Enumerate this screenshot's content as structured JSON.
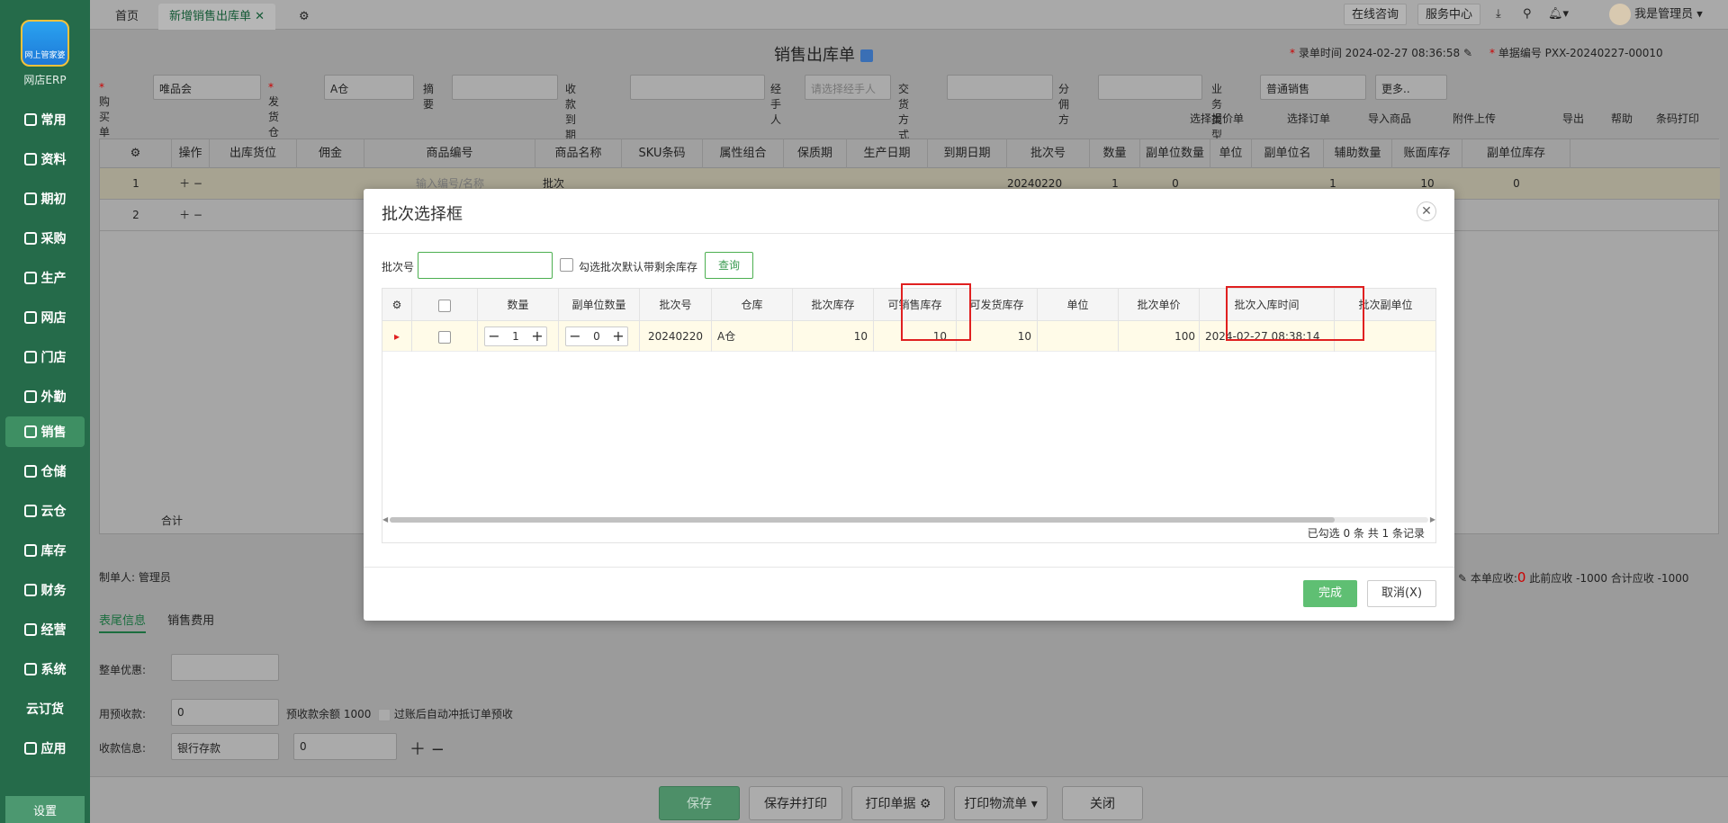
{
  "sidebar": {
    "logo_badge": "网上管家婆",
    "logo_text": "网店ERP",
    "items": [
      "常用",
      "资料",
      "期初",
      "采购",
      "生产",
      "网店",
      "门店",
      "外勤",
      "销售",
      "仓储",
      "云仓",
      "库存",
      "财务",
      "经营",
      "系统",
      "云订货",
      "应用"
    ],
    "bottom": "设置"
  },
  "topbar": {
    "tabs": [
      "首页",
      "新增销售出库单"
    ],
    "online": "在线咨询",
    "service": "服务中心",
    "user": "我是管理员"
  },
  "doc": {
    "title": "销售出库单",
    "time_label": "录单时间",
    "time_value": "2024-02-27 08:36:58",
    "no_label": "单据编号",
    "no_value": "PXX-20240227-00010"
  },
  "form": {
    "buyer_label": "购买单位",
    "buyer_value": "唯品会",
    "warehouse_label": "发货仓库",
    "warehouse_value": "A仓",
    "summary_label": "摘要",
    "due_label": "收款到期日期",
    "handler_label": "经手人",
    "handler_placeholder": "请选择经手人",
    "trade_label": "交货方式",
    "commission_label": "分佣方",
    "biz_label": "业务类型",
    "biz_value": "普通销售",
    "more": "更多.."
  },
  "toolbar2": {
    "quote": "选择报价单",
    "order": "选择订单",
    "import": "导入商品",
    "attach": "附件上传",
    "export": "导出",
    "help": "帮助",
    "barcode": "条码打印"
  },
  "grid": {
    "headers": [
      "操作",
      "出库货位",
      "佣金",
      "商品编号",
      "商品名称",
      "SKU条码",
      "属性组合",
      "保质期",
      "生产日期",
      "到期日期",
      "批次号",
      "数量",
      "副单位数量",
      "单位",
      "副单位名",
      "辅助数量",
      "账面库存",
      "副单位库存"
    ],
    "row1": {
      "no": "1",
      "code_placeholder": "输入编号/名称",
      "name": "批次",
      "batch": "20240220",
      "qty": "1",
      "subqty": "0",
      "aux": "1",
      "stock": "10",
      "substock": "0"
    },
    "row2": {
      "no": "2"
    },
    "total": "合计"
  },
  "footer": {
    "maker": "制单人: 管理员",
    "receivable_label": "本单应收:",
    "receivable_value": "0",
    "prev_label": "此前应收 -1000",
    "total_label": "合计应收 -1000",
    "tabs": [
      "表尾信息",
      "销售费用"
    ],
    "discount_label": "整单优惠:",
    "prepay_label": "用预收款:",
    "prepay_value": "0",
    "prepay_balance": "预收款余额 1000",
    "auto_offset": "过账后自动冲抵订单预收",
    "receipt_label": "收款信息:",
    "receipt_account": "银行存款",
    "receipt_value": "0"
  },
  "actions": {
    "save": "保存",
    "save_print": "保存并打印",
    "print_doc": "打印单据",
    "print_logistics": "打印物流单",
    "close": "关闭"
  },
  "modal": {
    "title": "批次选择框",
    "batch_label": "批次号",
    "batch_value": "",
    "check_label": "勾选批次默认带剩余库存",
    "query": "查询",
    "headers": [
      "数量",
      "副单位数量",
      "批次号",
      "仓库",
      "批次库存",
      "可销售库存",
      "可发货库存",
      "单位",
      "批次单价",
      "批次入库时间",
      "批次副单位"
    ],
    "row": {
      "qty": "1",
      "subqty": "0",
      "batch": "20240220",
      "warehouse": "A仓",
      "batch_stock": "10",
      "sellable": "10",
      "shippable": "10",
      "unit": "",
      "price": "100",
      "in_time": "2024-02-27 08:38:14"
    },
    "summary": "已勾选 0 条  共 1 条记录",
    "done": "完成",
    "cancel": "取消(X)"
  }
}
